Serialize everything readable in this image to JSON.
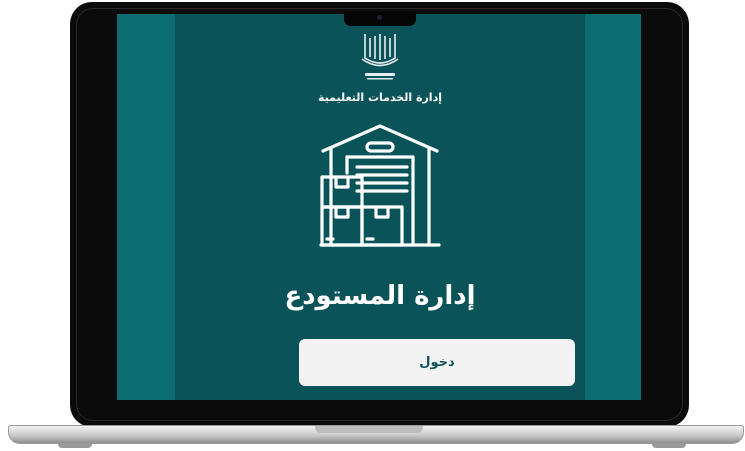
{
  "app": {
    "university_logo_alt": "Umm Al-Qura University",
    "department": "إدارة الخدمات التعليمية",
    "title": "إدارة المستودع",
    "login_label": "دخول"
  },
  "icons": {
    "logo": "university-logo-icon",
    "hero": "warehouse-icon"
  },
  "colors": {
    "screen_outer": "#0c6d70",
    "panel": "#0a5459",
    "button_bg": "#f2f2f2",
    "text": "#ffffff"
  }
}
